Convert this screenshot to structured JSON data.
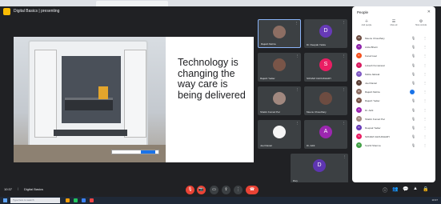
{
  "meeting": {
    "title": "Digital Basics | presenting",
    "time": "10:37",
    "code": "Digital Basics"
  },
  "slide": {
    "text": "Technology is changing the way care is being delivered"
  },
  "tiles": [
    {
      "name": "Rajesh Mehta",
      "initial": "",
      "color": "#8d6e63",
      "active": true
    },
    {
      "name": "Dr. Deepak Yadav",
      "initial": "D",
      "color": "#673ab7",
      "active": false
    },
    {
      "name": "Rajesh Yadav",
      "initial": "",
      "color": "#795548",
      "active": false
    },
    {
      "name": "SONAM CHOUDHARY",
      "initial": "S",
      "color": "#e91e63",
      "active": false
    },
    {
      "name": "Shalini Kumari Pal",
      "initial": "",
      "color": "#a1887f",
      "active": false
    },
    {
      "name": "Meenu Choudhary",
      "initial": "",
      "color": "#6d4c41",
      "active": false
    },
    {
      "name": "Joel Daniel",
      "initial": "",
      "color": "#f5f5f5",
      "active": false
    },
    {
      "name": "Dr. Aditi",
      "initial": "A",
      "color": "#9c27b0",
      "active": false
    },
    {
      "name": "Divy",
      "initial": "D",
      "color": "#5e35b1",
      "active": false
    }
  ],
  "panel": {
    "title": "People",
    "close": "✕",
    "actions": [
      {
        "icon": "＋",
        "label": "Add people"
      },
      {
        "icon": "☰",
        "label": "Mute all"
      },
      {
        "icon": "⚙",
        "label": "Host controls"
      }
    ],
    "participants": [
      {
        "name": "Meenu Choudhary",
        "initial": "M",
        "color": "#6d4c41"
      },
      {
        "name": "Anita Bharti",
        "initial": "A",
        "color": "#8e24aa"
      },
      {
        "name": "Kunal Goel",
        "initial": "K",
        "color": "#f4511e"
      },
      {
        "name": "Lokesh Kumaravel",
        "initial": "L",
        "color": "#d81b60"
      },
      {
        "name": "Nikita Jaiswal",
        "initial": "N",
        "color": "#7e57c2"
      },
      {
        "name": "Joel Daniel",
        "initial": "J",
        "color": "#5d4037"
      },
      {
        "name": "Rajesh Mehta",
        "initial": "R",
        "color": "#8d6e63"
      },
      {
        "name": "Rajesh Yadav",
        "initial": "R",
        "color": "#795548"
      },
      {
        "name": "Dr. Aditi",
        "initial": "A",
        "color": "#9c27b0"
      },
      {
        "name": "Shalini Kumari Pal",
        "initial": "S",
        "color": "#a1887f"
      },
      {
        "name": "Deepak Yadav",
        "initial": "D",
        "color": "#673ab7"
      },
      {
        "name": "SONAM CHOUDHARY",
        "initial": "S",
        "color": "#e91e63"
      },
      {
        "name": "Sushil Sharma",
        "initial": "S",
        "color": "#43a047"
      }
    ]
  },
  "taskbar": {
    "search": "Type here to search",
    "clock": "10:37"
  },
  "colors": {
    "accent": "#1a73e8",
    "end_call": "#ea4335",
    "meet_bg": "#202124"
  }
}
